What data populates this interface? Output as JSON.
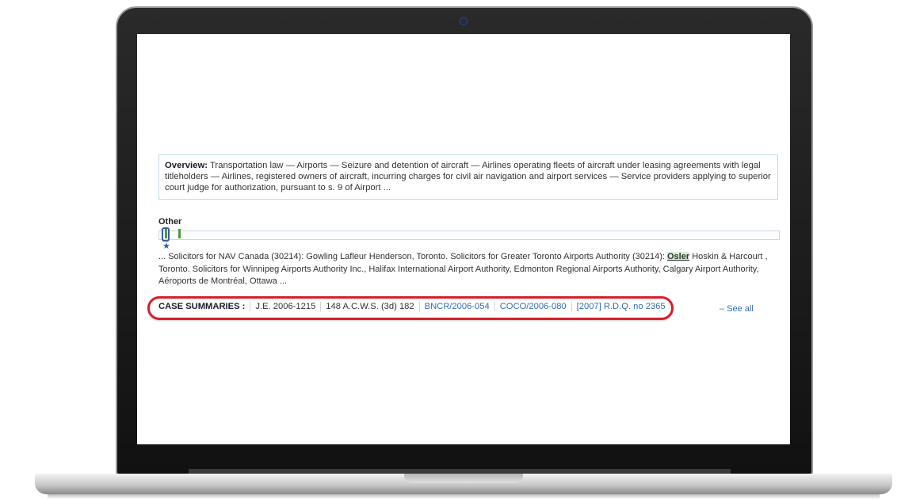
{
  "overview": {
    "label": "Overview:",
    "text": "Transportation law — Airports — Seizure and detention of aircraft — Airlines operating fleets of aircraft under leasing agreements with legal titleholders — Airlines, registered owners of aircraft, incurring charges for civil air navigation and airport services — Service providers applying to superior court judge for authorization, pursuant to s. 9 of Airport ..."
  },
  "other": {
    "label": "Other",
    "star": "★"
  },
  "snippet": {
    "before": "... Solicitors for NAV Canada (30214): Gowling Lafleur Henderson, Toronto. Solicitors for Greater Toronto Airports Authority (30214): ",
    "highlight": "Osler",
    "after": " Hoskin & Harcourt , Toronto. Solicitors for Winnipeg Airports Authority Inc., Halifax International Airport Authority, Edmonton Regional Airports Authority, Calgary Airport Authority, Aéroports de Montréal, Ottawa ..."
  },
  "case_summaries": {
    "label": "CASE SUMMARIES :",
    "citations": [
      {
        "text": "J.E. 2006-1215",
        "link": false
      },
      {
        "text": "148 A.C.W.S. (3d) 182",
        "link": false
      },
      {
        "text": "BNCR/2006-054",
        "link": true
      },
      {
        "text": "COCO/2006-080",
        "link": true
      },
      {
        "text": "[2007] R.D.Q. no 2365",
        "link": true
      }
    ],
    "see_all": "– See all"
  },
  "colors": {
    "link": "#2f6db5",
    "annotation": "#d81e2a",
    "hit_marker": "#4a9a3a"
  }
}
